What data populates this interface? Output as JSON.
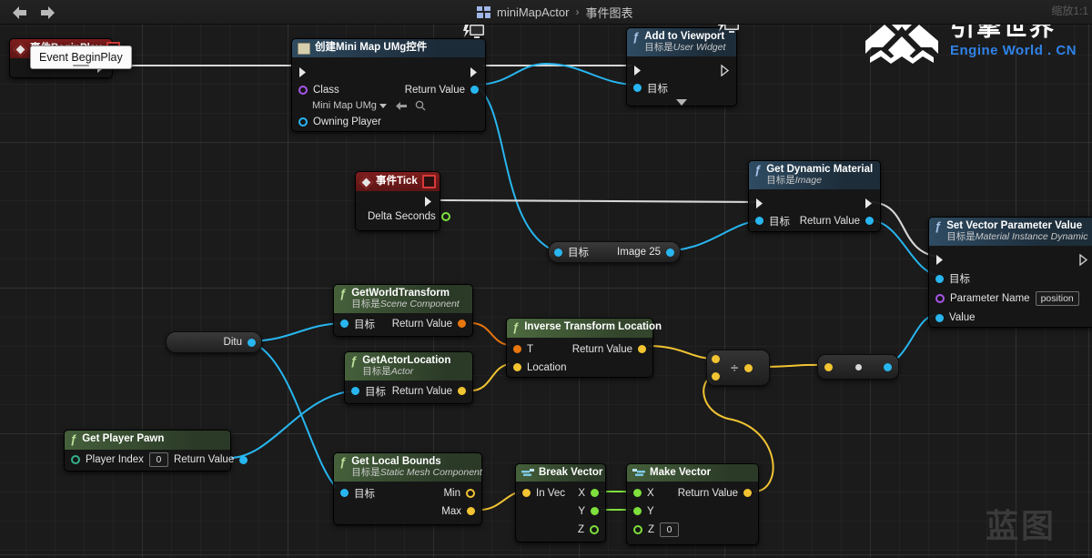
{
  "window": {
    "zoom_label": "缩放1:1",
    "watermark": "蓝图"
  },
  "breadcrumb": {
    "icon": "blueprint-grid-icon",
    "asset": "miniMapActor",
    "separator": "›",
    "graph": "事件图表"
  },
  "toolbar": {
    "back_icon": "back-arrow-icon",
    "forward_icon": "forward-arrow-icon"
  },
  "logo": {
    "cn": "引擎世界",
    "en": "Engine World . CN"
  },
  "tooltip": {
    "text": "Event BeginPlay"
  },
  "nodes": {
    "event_begin_play": {
      "title": "事件BeginPlay",
      "icon": "event-diamond-icon",
      "stop_icon": "stop-square-icon"
    },
    "create_widget": {
      "title": "创建Mini Map UMg控件",
      "icon": "widget-box-icon",
      "badge_icon": "monitor-bolt-icon",
      "class_label": "Class",
      "class_value": "Mini Map UMg",
      "owning_player_label": "Owning Player",
      "return_label": "Return Value",
      "browse_icon": "browse-arrow-icon",
      "search_icon": "magnifier-icon"
    },
    "add_to_viewport": {
      "title": "Add to Viewport",
      "subtitle_prefix": "目标是",
      "subtitle": "User Widget",
      "badge_icon": "monitor-bolt-icon",
      "target_label": "目标",
      "expand_icon": "chevron-down-icon"
    },
    "event_tick": {
      "title": "事件Tick",
      "icon": "event-diamond-icon",
      "stop_icon": "stop-square-icon",
      "delta_label": "Delta Seconds"
    },
    "image_knot": {
      "target_label": "目标",
      "value_label": "Image 25"
    },
    "get_dynamic_material": {
      "title": "Get Dynamic Material",
      "subtitle_prefix": "目标是",
      "subtitle": "Image",
      "target_label": "目标",
      "return_label": "Return Value"
    },
    "set_vector_parameter": {
      "title": "Set Vector Parameter Value",
      "subtitle_prefix": "目标是",
      "subtitle": "Material Instance Dynamic",
      "target_label": "目标",
      "param_name_label": "Parameter Name",
      "param_name_value": "position",
      "value_label": "Value"
    },
    "get_world_transform": {
      "title": "GetWorldTransform",
      "subtitle_prefix": "目标是",
      "subtitle": "Scene Component",
      "target_label": "目标",
      "return_label": "Return Value"
    },
    "get_actor_location": {
      "title": "GetActorLocation",
      "subtitle_prefix": "目标是",
      "subtitle": "Actor",
      "target_label": "目标",
      "return_label": "Return Value"
    },
    "inverse_transform_location": {
      "title": "Inverse Transform Location",
      "t_label": "T",
      "location_label": "Location",
      "return_label": "Return Value"
    },
    "ditu_knot": {
      "label": "Ditu"
    },
    "get_player_pawn": {
      "title": "Get Player Pawn",
      "player_index_label": "Player Index",
      "player_index_value": "0",
      "return_label": "Return Value"
    },
    "get_local_bounds": {
      "title": "Get Local Bounds",
      "subtitle_prefix": "目标是",
      "subtitle": "Static Mesh Component",
      "target_label": "目标",
      "min_label": "Min",
      "max_label": "Max"
    },
    "break_vector": {
      "title": "Break Vector",
      "icon": "break-pin-icon",
      "in_vec_label": "In Vec",
      "x_label": "X",
      "y_label": "Y",
      "z_label": "Z"
    },
    "make_vector": {
      "title": "Make Vector",
      "icon": "make-pin-icon",
      "x_label": "X",
      "y_label": "Y",
      "z_label": "Z",
      "z_value": "0",
      "return_label": "Return Value"
    },
    "divide_node": {
      "symbol": "÷"
    },
    "convert_node": {
      "symbol": "•"
    }
  },
  "colors": {
    "exec_white": "#e8e8e8",
    "object_blue": "#28b6f0",
    "float_green": "#7ee03c",
    "vector_yellow": "#f2c432",
    "transform_orange": "#e8760f",
    "class_purple": "#a855e8",
    "event_red": "#7e1d1d",
    "accent_blue": "#2f83e8"
  }
}
